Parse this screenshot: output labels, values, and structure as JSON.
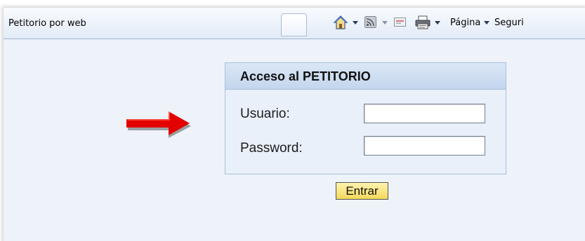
{
  "browser": {
    "tab_title": "Petitorio por web",
    "toolbar": {
      "home_icon": "home-icon",
      "feeds_icon": "rss-feed-icon",
      "mail_icon": "mail-icon",
      "print_icon": "print-icon",
      "page_menu": "Página",
      "safety_menu": "Seguri"
    }
  },
  "login": {
    "title": "Acceso al PETITORIO",
    "username_label": "Usuario:",
    "username_value": "",
    "password_label": "Password:",
    "password_value": "",
    "submit_label": "Entrar"
  },
  "annotation": {
    "icon": "red-arrow-icon",
    "color": "#e30000"
  },
  "colors": {
    "content_background": "#eef3fa",
    "panel_header": "#c9daf0",
    "button_fill": "#f6de6c"
  }
}
